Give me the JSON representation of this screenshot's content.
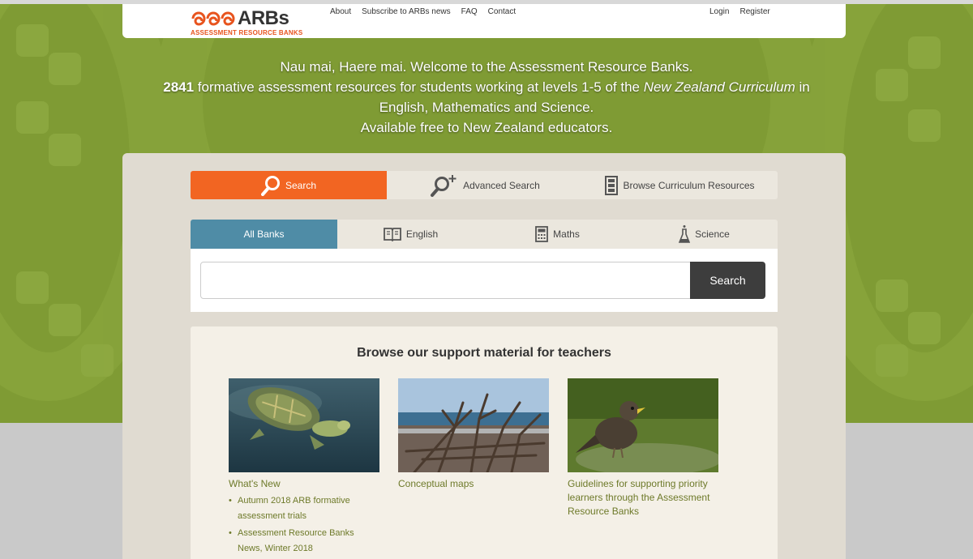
{
  "header": {
    "logo_text": "ARBs",
    "logo_sub": "ASSESSMENT RESOURCE BANKS",
    "nav": [
      "About",
      "Subscribe to ARBs news",
      "FAQ",
      "Contact"
    ],
    "login": "Login",
    "register": "Register"
  },
  "hero": {
    "line1": "Nau mai, Haere mai. Welcome to the Assessment Resource Banks.",
    "count": "2841",
    "line2a": " formative assessment resources for students working at levels 1-5 of the ",
    "line2b": "New Zealand Curriculum",
    "line2c": " in",
    "line3": "English, Mathematics and Science.",
    "line4": "Available free to New Zealand educators."
  },
  "search_tabs": [
    "Search",
    "Advanced Search",
    "Browse Curriculum Resources"
  ],
  "bank_tabs": [
    "All Banks",
    "English",
    "Maths",
    "Science"
  ],
  "search": {
    "placeholder": "",
    "button": "Search"
  },
  "support": {
    "heading": "Browse our support material for teachers",
    "cards": [
      {
        "title": "What's New",
        "items": [
          "Autumn 2018 ARB formative assessment trials",
          "Assessment Resource Banks News, Winter 2018"
        ]
      },
      {
        "title": "Conceptual maps"
      },
      {
        "title": "Guidelines for supporting priority learners through the Assessment Resource Banks"
      }
    ]
  },
  "colors": {
    "green": "#7f9b34",
    "orange": "#f26522",
    "blue_tab": "#4f8ca6",
    "link_green": "#6e7a2a"
  }
}
